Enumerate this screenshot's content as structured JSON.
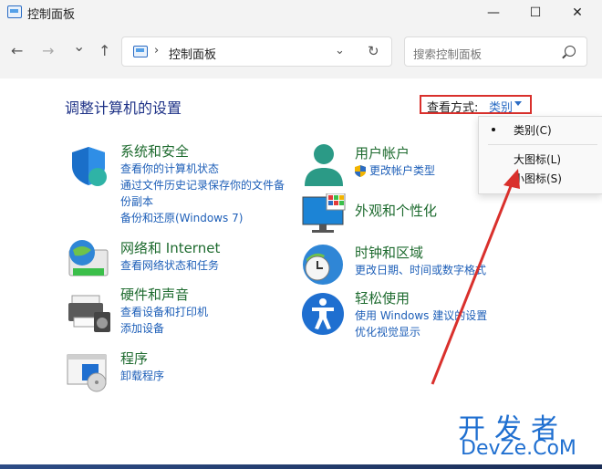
{
  "window": {
    "title": "控制面板",
    "controls": {
      "minimize": "—",
      "maximize": "☐",
      "close": "✕"
    }
  },
  "nav": {
    "back": "←",
    "forward": "→",
    "recent": "⌄",
    "up": "↑",
    "address": {
      "separator": "›",
      "path": "控制面板",
      "dropdown": "⌄",
      "refresh": "↻"
    },
    "search_placeholder": "搜索控制面板"
  },
  "content": {
    "heading": "调整计算机的设置",
    "view_by": {
      "label": "查看方式:",
      "value": "类别"
    },
    "categories": [
      {
        "title": "系统和安全",
        "links": [
          "查看你的计算机状态",
          "通过文件历史记录保存你的文件备",
          "份副本",
          "备份和还原(Windows 7)"
        ],
        "icon": "shield-icon"
      },
      {
        "title": "网络和 Internet",
        "links": [
          "查看网络状态和任务"
        ],
        "icon": "network-globe-icon"
      },
      {
        "title": "硬件和声音",
        "links": [
          "查看设备和打印机",
          "添加设备"
        ],
        "icon": "printer-icon"
      },
      {
        "title": "程序",
        "links": [
          "卸载程序"
        ],
        "icon": "programs-icon"
      },
      {
        "title": "用户帐户",
        "links": [
          "更改帐户类型"
        ],
        "icon": "user-icon"
      },
      {
        "title": "外观和个性化",
        "links": [],
        "icon": "monitor-icon"
      },
      {
        "title": "时钟和区域",
        "links": [
          "更改日期、时间或数字格式"
        ],
        "icon": "clock-globe-icon"
      },
      {
        "title": "轻松使用",
        "links": [
          "使用 Windows 建议的设置",
          "优化视觉显示"
        ],
        "icon": "accessibility-icon"
      }
    ]
  },
  "view_menu": {
    "items": [
      {
        "label": "类别(C)",
        "selected": true
      },
      {
        "label": "大图标(L)",
        "selected": false
      },
      {
        "label": "小图标(S)",
        "selected": false
      }
    ]
  },
  "watermark": {
    "line1": "开发者",
    "line2": "DevZe.CoM"
  },
  "colors": {
    "accent": "#2b6cc4",
    "highlight_box": "#d9302c",
    "category_title": "#1e6b2f",
    "link": "#1e5fb8",
    "heading": "#1e3287"
  }
}
